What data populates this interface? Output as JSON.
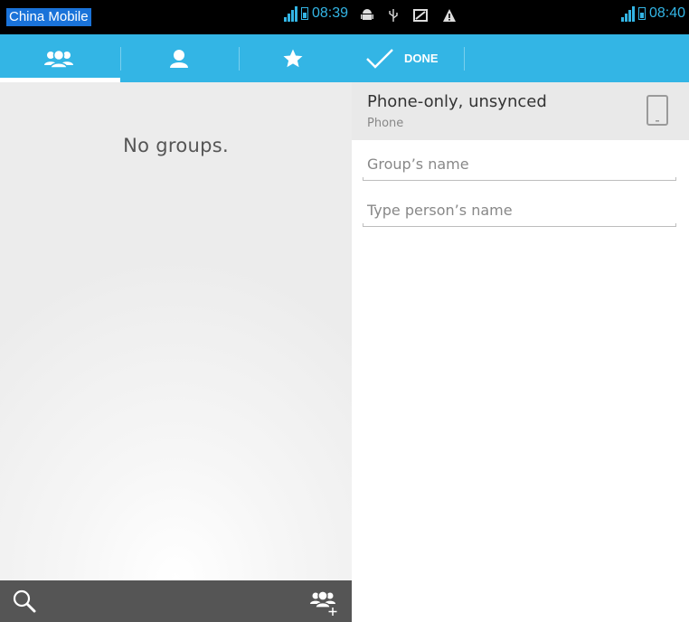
{
  "left_screen": {
    "statusbar": {
      "carrier": "China Mobile",
      "time": "08:39"
    },
    "tabs": [
      {
        "name": "groups",
        "icon": "group-icon",
        "selected": true
      },
      {
        "name": "contacts",
        "icon": "person-icon",
        "selected": false
      },
      {
        "name": "favorites",
        "icon": "star-icon",
        "selected": false
      }
    ],
    "empty_message": "No groups.",
    "bottombar": {
      "search_icon": "search-icon",
      "add_group_icon": "add-group-icon"
    }
  },
  "right_screen": {
    "statusbar": {
      "time": "08:40",
      "notification_icons": [
        "android-icon",
        "usb-icon",
        "screenshot-icon",
        "warning-icon"
      ]
    },
    "actionbar": {
      "done_label": "DONE"
    },
    "account": {
      "title": "Phone-only, unsynced",
      "subtitle": "Phone",
      "icon": "phone-device-icon"
    },
    "group_name_field": {
      "value": "",
      "placeholder": "Group’s name"
    },
    "person_name_field": {
      "value": "",
      "placeholder": "Type person’s name"
    }
  },
  "colors": {
    "accent": "#33b5e5",
    "statusbar": "#000000",
    "bottombar": "#555555",
    "account_row": "#e9e9e9"
  }
}
